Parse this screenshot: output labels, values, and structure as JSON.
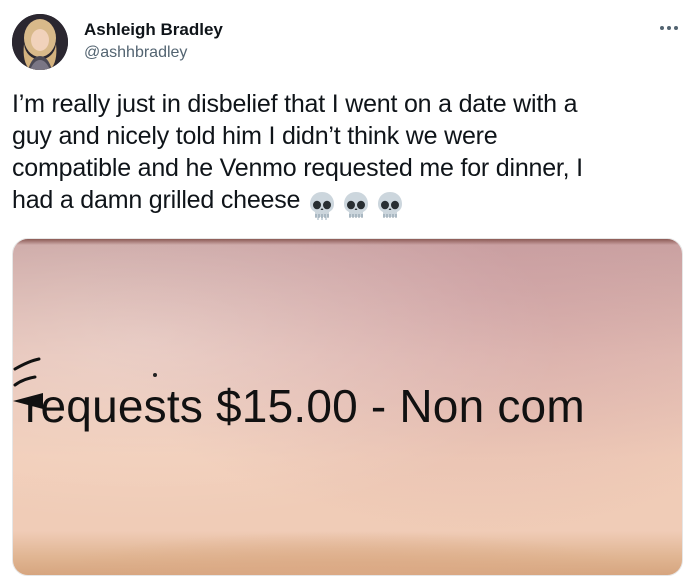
{
  "tweet": {
    "author_name": "Ashleigh Bradley",
    "author_handle": "@ashhbradley",
    "more_icon": "more-horizontal-icon",
    "text_lines": [
      "I’m really just in disbelief that I went on a date with a",
      "guy and nicely told him I didn’t think we were",
      "compatible and he Venmo requested me for dinner, I",
      "had a damn grilled cheese"
    ],
    "emoji": [
      "skull-icon",
      "skull-icon",
      "skull-icon"
    ]
  },
  "media": {
    "caption_text": "requests $15.00 - Non com"
  },
  "colors": {
    "text_primary": "#0f1419",
    "text_secondary": "#536471"
  }
}
